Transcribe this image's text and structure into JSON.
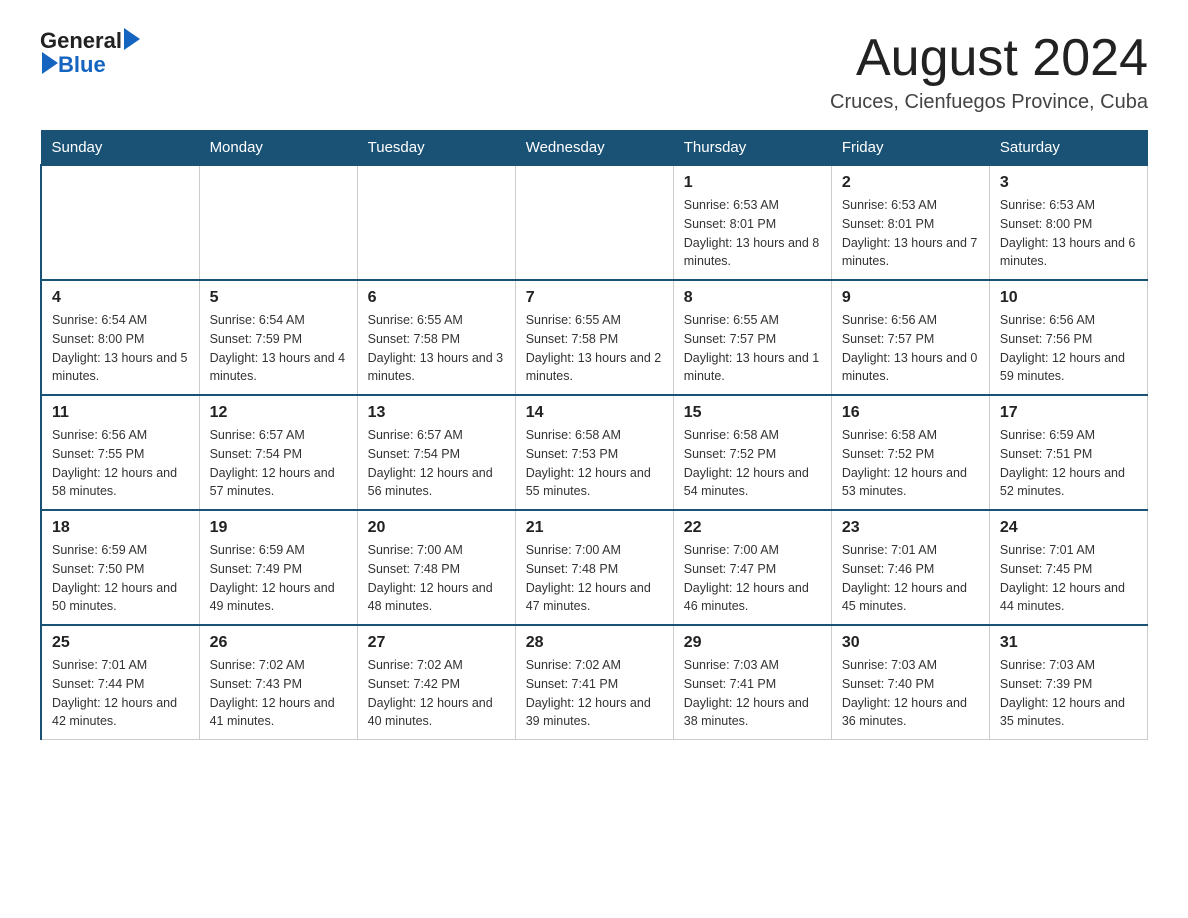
{
  "header": {
    "logo_text_general": "General",
    "logo_text_blue": "Blue",
    "month_title": "August 2024",
    "location": "Cruces, Cienfuegos Province, Cuba"
  },
  "days_of_week": [
    "Sunday",
    "Monday",
    "Tuesday",
    "Wednesday",
    "Thursday",
    "Friday",
    "Saturday"
  ],
  "weeks": [
    {
      "days": [
        {
          "number": "",
          "info": ""
        },
        {
          "number": "",
          "info": ""
        },
        {
          "number": "",
          "info": ""
        },
        {
          "number": "",
          "info": ""
        },
        {
          "number": "1",
          "info": "Sunrise: 6:53 AM\nSunset: 8:01 PM\nDaylight: 13 hours and 8 minutes."
        },
        {
          "number": "2",
          "info": "Sunrise: 6:53 AM\nSunset: 8:01 PM\nDaylight: 13 hours and 7 minutes."
        },
        {
          "number": "3",
          "info": "Sunrise: 6:53 AM\nSunset: 8:00 PM\nDaylight: 13 hours and 6 minutes."
        }
      ]
    },
    {
      "days": [
        {
          "number": "4",
          "info": "Sunrise: 6:54 AM\nSunset: 8:00 PM\nDaylight: 13 hours and 5 minutes."
        },
        {
          "number": "5",
          "info": "Sunrise: 6:54 AM\nSunset: 7:59 PM\nDaylight: 13 hours and 4 minutes."
        },
        {
          "number": "6",
          "info": "Sunrise: 6:55 AM\nSunset: 7:58 PM\nDaylight: 13 hours and 3 minutes."
        },
        {
          "number": "7",
          "info": "Sunrise: 6:55 AM\nSunset: 7:58 PM\nDaylight: 13 hours and 2 minutes."
        },
        {
          "number": "8",
          "info": "Sunrise: 6:55 AM\nSunset: 7:57 PM\nDaylight: 13 hours and 1 minute."
        },
        {
          "number": "9",
          "info": "Sunrise: 6:56 AM\nSunset: 7:57 PM\nDaylight: 13 hours and 0 minutes."
        },
        {
          "number": "10",
          "info": "Sunrise: 6:56 AM\nSunset: 7:56 PM\nDaylight: 12 hours and 59 minutes."
        }
      ]
    },
    {
      "days": [
        {
          "number": "11",
          "info": "Sunrise: 6:56 AM\nSunset: 7:55 PM\nDaylight: 12 hours and 58 minutes."
        },
        {
          "number": "12",
          "info": "Sunrise: 6:57 AM\nSunset: 7:54 PM\nDaylight: 12 hours and 57 minutes."
        },
        {
          "number": "13",
          "info": "Sunrise: 6:57 AM\nSunset: 7:54 PM\nDaylight: 12 hours and 56 minutes."
        },
        {
          "number": "14",
          "info": "Sunrise: 6:58 AM\nSunset: 7:53 PM\nDaylight: 12 hours and 55 minutes."
        },
        {
          "number": "15",
          "info": "Sunrise: 6:58 AM\nSunset: 7:52 PM\nDaylight: 12 hours and 54 minutes."
        },
        {
          "number": "16",
          "info": "Sunrise: 6:58 AM\nSunset: 7:52 PM\nDaylight: 12 hours and 53 minutes."
        },
        {
          "number": "17",
          "info": "Sunrise: 6:59 AM\nSunset: 7:51 PM\nDaylight: 12 hours and 52 minutes."
        }
      ]
    },
    {
      "days": [
        {
          "number": "18",
          "info": "Sunrise: 6:59 AM\nSunset: 7:50 PM\nDaylight: 12 hours and 50 minutes."
        },
        {
          "number": "19",
          "info": "Sunrise: 6:59 AM\nSunset: 7:49 PM\nDaylight: 12 hours and 49 minutes."
        },
        {
          "number": "20",
          "info": "Sunrise: 7:00 AM\nSunset: 7:48 PM\nDaylight: 12 hours and 48 minutes."
        },
        {
          "number": "21",
          "info": "Sunrise: 7:00 AM\nSunset: 7:48 PM\nDaylight: 12 hours and 47 minutes."
        },
        {
          "number": "22",
          "info": "Sunrise: 7:00 AM\nSunset: 7:47 PM\nDaylight: 12 hours and 46 minutes."
        },
        {
          "number": "23",
          "info": "Sunrise: 7:01 AM\nSunset: 7:46 PM\nDaylight: 12 hours and 45 minutes."
        },
        {
          "number": "24",
          "info": "Sunrise: 7:01 AM\nSunset: 7:45 PM\nDaylight: 12 hours and 44 minutes."
        }
      ]
    },
    {
      "days": [
        {
          "number": "25",
          "info": "Sunrise: 7:01 AM\nSunset: 7:44 PM\nDaylight: 12 hours and 42 minutes."
        },
        {
          "number": "26",
          "info": "Sunrise: 7:02 AM\nSunset: 7:43 PM\nDaylight: 12 hours and 41 minutes."
        },
        {
          "number": "27",
          "info": "Sunrise: 7:02 AM\nSunset: 7:42 PM\nDaylight: 12 hours and 40 minutes."
        },
        {
          "number": "28",
          "info": "Sunrise: 7:02 AM\nSunset: 7:41 PM\nDaylight: 12 hours and 39 minutes."
        },
        {
          "number": "29",
          "info": "Sunrise: 7:03 AM\nSunset: 7:41 PM\nDaylight: 12 hours and 38 minutes."
        },
        {
          "number": "30",
          "info": "Sunrise: 7:03 AM\nSunset: 7:40 PM\nDaylight: 12 hours and 36 minutes."
        },
        {
          "number": "31",
          "info": "Sunrise: 7:03 AM\nSunset: 7:39 PM\nDaylight: 12 hours and 35 minutes."
        }
      ]
    }
  ]
}
